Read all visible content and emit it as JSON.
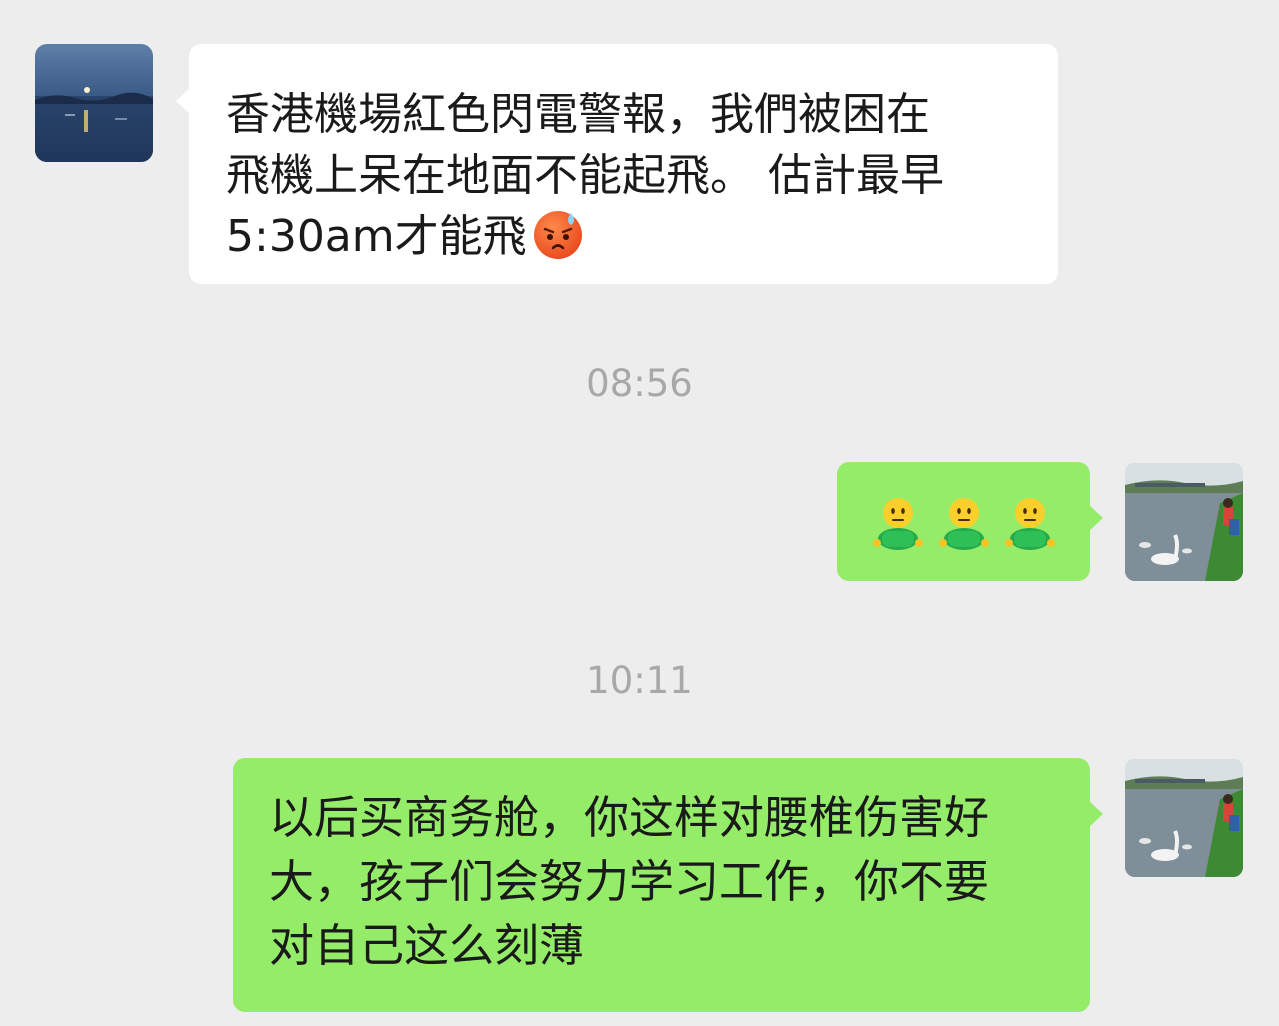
{
  "messages": [
    {
      "side": "left",
      "line1": "香港機場紅色閃電警報，我們被困在",
      "line2": "飛機上呆在地面不能起飛。 估計最早",
      "line3": "5:30am才能飛",
      "emoji_icon": "anxious-sweat-face-icon"
    },
    {
      "side": "right",
      "emoji_icons": [
        "person-icon",
        "person-icon",
        "person-icon"
      ]
    },
    {
      "side": "right",
      "line1": "以后买商务舱，你这样对腰椎伤害好",
      "line2": "大，孩子们会努力学习工作，你不要",
      "line3": "对自己这么刻薄"
    }
  ],
  "timestamps": [
    "08:56",
    "10:11"
  ],
  "colors": {
    "background": "#ededed",
    "incoming_bubble": "#ffffff",
    "outgoing_bubble": "#95ec69",
    "timestamp": "#a8a8a8"
  }
}
